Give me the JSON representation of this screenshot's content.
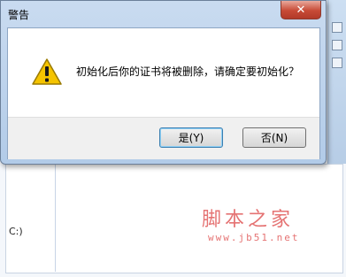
{
  "dialog": {
    "title": "警告",
    "close_glyph": "✕",
    "icon": "warning-icon",
    "message": "初始化后你的证书将被删除，请确定要初始化？",
    "buttons": {
      "yes": "是(Y)",
      "no": "否(N)"
    }
  },
  "background": {
    "drive_label": "C:)"
  },
  "watermark": {
    "text": "脚本之家",
    "url": "www.jb51.net"
  },
  "colors": {
    "warning_fill": "#f5c400",
    "warning_stroke": "#9a7a00",
    "close_button": "#c74a36",
    "watermark": "#e57373"
  }
}
